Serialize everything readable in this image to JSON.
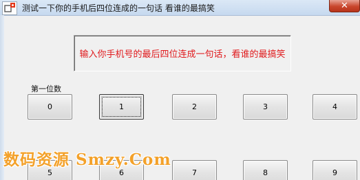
{
  "window": {
    "title": "测试一下你的手机后四位连成的一句话  看谁的最搞笑",
    "close_label": "✕"
  },
  "message": {
    "text": "输入你手机号的最后四位连成一句话，看谁的最搞笑",
    "color": "#e0191c"
  },
  "digit_label": "第一位数",
  "buttons": {
    "b0": "0",
    "b1": "1",
    "b2": "2",
    "b3": "3",
    "b4": "4",
    "b5": "5",
    "b6": "6",
    "b7": "7",
    "b8": "8",
    "b9": "9"
  },
  "focused_button": "1",
  "watermark": "数码资源 Smzy.Com",
  "icons": {
    "app": "app-icon",
    "close": "close-icon"
  }
}
